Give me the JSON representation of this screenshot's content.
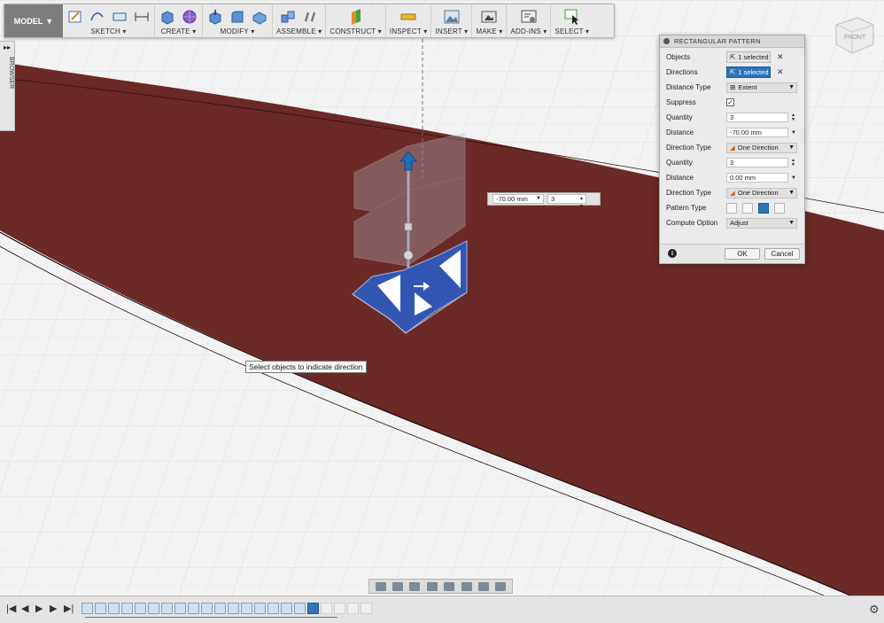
{
  "toolbar": {
    "workspace": "MODEL",
    "groups": [
      {
        "label": "SKETCH"
      },
      {
        "label": "CREATE"
      },
      {
        "label": "MODIFY"
      },
      {
        "label": "ASSEMBLE"
      },
      {
        "label": "CONSTRUCT"
      },
      {
        "label": "INSPECT"
      },
      {
        "label": "INSERT"
      },
      {
        "label": "MAKE"
      },
      {
        "label": "ADD-INS"
      },
      {
        "label": "SELECT"
      }
    ]
  },
  "browser": {
    "label": "BROWSER"
  },
  "viewcube": {
    "face": "FRONT"
  },
  "dialog": {
    "title": "RECTANGULAR PATTERN",
    "objects": {
      "label": "Objects",
      "value": "1 selected"
    },
    "directions": {
      "label": "Directions",
      "value": "1 selected"
    },
    "distance_type": {
      "label": "Distance Type",
      "value": "Extent"
    },
    "suppress": {
      "label": "Suppress",
      "checked": true,
      "mark": "✓"
    },
    "quantity1": {
      "label": "Quantity",
      "value": "3"
    },
    "distance1": {
      "label": "Distance",
      "value": "-70.00 mm"
    },
    "direction_type1": {
      "label": "Direction Type",
      "value": "One Direction"
    },
    "quantity2": {
      "label": "Quantity",
      "value": "3"
    },
    "distance2": {
      "label": "Distance",
      "value": "0.00 mm"
    },
    "direction_type2": {
      "label": "Direction Type",
      "value": "One Direction"
    },
    "pattern_type": {
      "label": "Pattern Type",
      "selected_index": 2
    },
    "compute_option": {
      "label": "Compute Option",
      "value": "Adjust"
    },
    "info": "i",
    "ok": "OK",
    "cancel": "Cancel"
  },
  "canvas_input": {
    "distance": "-70.00 mm",
    "quantity": "3"
  },
  "tooltip": "Select objects to indicate direction",
  "colors": {
    "body": "#6b2a26",
    "selection_blue": "#2a5fb8",
    "active_blue": "#2e74b8"
  },
  "icons": {
    "settings": "gear-icon",
    "play_first": "|◀",
    "play_prev": "◀",
    "play": "▶",
    "play_next": "▶",
    "play_last": "▶|",
    "gear_glyph": "⚙"
  }
}
